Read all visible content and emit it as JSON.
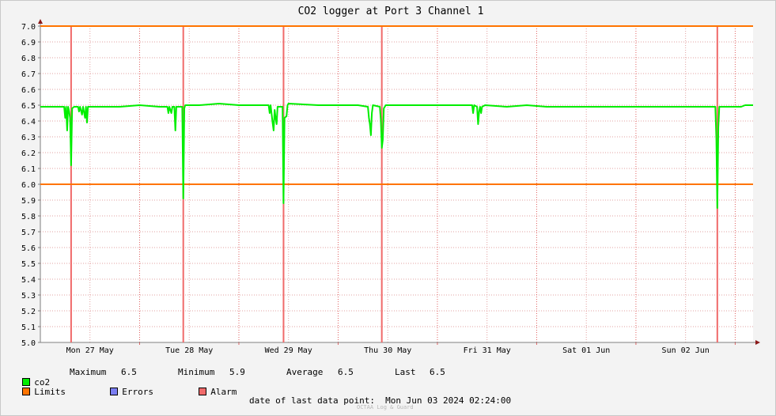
{
  "chart_data": {
    "type": "line",
    "title": "CO2 logger at Port 3 Channel 1",
    "ylim": [
      5.0,
      7.0
    ],
    "y_ticks": [
      "5.0",
      "5.1",
      "5.2",
      "5.3",
      "5.4",
      "5.5",
      "5.6",
      "5.7",
      "5.8",
      "5.9",
      "6.0",
      "6.1",
      "6.2",
      "6.3",
      "6.4",
      "6.5",
      "6.6",
      "6.7",
      "6.8",
      "6.9",
      "7.0"
    ],
    "x_range_days": [
      0,
      7.18
    ],
    "x_ticks": [
      {
        "label": "Mon 27 May",
        "day": 0.5
      },
      {
        "label": "Tue 28 May",
        "day": 1.5
      },
      {
        "label": "Wed 29 May",
        "day": 2.5
      },
      {
        "label": "Thu 30 May",
        "day": 3.5
      },
      {
        "label": "Fri 31 May",
        "day": 4.5
      },
      {
        "label": "Sat 01 Jun",
        "day": 5.5
      },
      {
        "label": "Sun 02 Jun",
        "day": 6.5
      }
    ],
    "grid": true,
    "limits": {
      "upper": 7.0,
      "lower": 6.0,
      "color": "#ff7400"
    },
    "alarms": {
      "days": [
        0.31,
        1.44,
        2.45,
        3.44,
        6.82
      ],
      "color": "#f06a6a"
    },
    "series": [
      {
        "name": "co2",
        "color": "#00ee00",
        "points": [
          [
            0.0,
            6.49
          ],
          [
            0.2,
            6.49
          ],
          [
            0.24,
            6.49
          ],
          [
            0.25,
            6.42
          ],
          [
            0.26,
            6.49
          ],
          [
            0.27,
            6.34
          ],
          [
            0.28,
            6.49
          ],
          [
            0.29,
            6.46
          ],
          [
            0.3,
            6.42
          ],
          [
            0.31,
            6.12
          ],
          [
            0.32,
            6.48
          ],
          [
            0.34,
            6.49
          ],
          [
            0.38,
            6.49
          ],
          [
            0.39,
            6.46
          ],
          [
            0.4,
            6.49
          ],
          [
            0.42,
            6.44
          ],
          [
            0.43,
            6.49
          ],
          [
            0.45,
            6.42
          ],
          [
            0.46,
            6.49
          ],
          [
            0.47,
            6.39
          ],
          [
            0.48,
            6.49
          ],
          [
            0.6,
            6.49
          ],
          [
            0.8,
            6.49
          ],
          [
            1.0,
            6.5
          ],
          [
            1.2,
            6.49
          ],
          [
            1.28,
            6.49
          ],
          [
            1.29,
            6.45
          ],
          [
            1.3,
            6.49
          ],
          [
            1.32,
            6.45
          ],
          [
            1.33,
            6.49
          ],
          [
            1.35,
            6.49
          ],
          [
            1.36,
            6.34
          ],
          [
            1.37,
            6.49
          ],
          [
            1.4,
            6.49
          ],
          [
            1.43,
            6.49
          ],
          [
            1.44,
            5.91
          ],
          [
            1.45,
            6.48
          ],
          [
            1.46,
            6.5
          ],
          [
            1.6,
            6.5
          ],
          [
            1.8,
            6.51
          ],
          [
            2.0,
            6.5
          ],
          [
            2.2,
            6.5
          ],
          [
            2.3,
            6.5
          ],
          [
            2.31,
            6.45
          ],
          [
            2.32,
            6.5
          ],
          [
            2.34,
            6.39
          ],
          [
            2.35,
            6.34
          ],
          [
            2.36,
            6.47
          ],
          [
            2.37,
            6.42
          ],
          [
            2.38,
            6.38
          ],
          [
            2.39,
            6.49
          ],
          [
            2.42,
            6.49
          ],
          [
            2.44,
            6.49
          ],
          [
            2.45,
            5.88
          ],
          [
            2.46,
            6.42
          ],
          [
            2.48,
            6.43
          ],
          [
            2.49,
            6.5
          ],
          [
            2.5,
            6.51
          ],
          [
            2.8,
            6.5
          ],
          [
            3.0,
            6.5
          ],
          [
            3.2,
            6.5
          ],
          [
            3.3,
            6.49
          ],
          [
            3.31,
            6.42
          ],
          [
            3.32,
            6.38
          ],
          [
            3.33,
            6.31
          ],
          [
            3.34,
            6.45
          ],
          [
            3.35,
            6.5
          ],
          [
            3.42,
            6.49
          ],
          [
            3.43,
            6.41
          ],
          [
            3.44,
            6.23
          ],
          [
            3.45,
            6.28
          ],
          [
            3.46,
            6.48
          ],
          [
            3.48,
            6.5
          ],
          [
            3.7,
            6.5
          ],
          [
            3.9,
            6.5
          ],
          [
            4.1,
            6.5
          ],
          [
            4.3,
            6.5
          ],
          [
            4.35,
            6.5
          ],
          [
            4.36,
            6.45
          ],
          [
            4.37,
            6.5
          ],
          [
            4.4,
            6.49
          ],
          [
            4.41,
            6.38
          ],
          [
            4.42,
            6.46
          ],
          [
            4.43,
            6.49
          ],
          [
            4.44,
            6.45
          ],
          [
            4.45,
            6.49
          ],
          [
            4.48,
            6.5
          ],
          [
            4.7,
            6.49
          ],
          [
            4.9,
            6.5
          ],
          [
            5.1,
            6.49
          ],
          [
            5.3,
            6.49
          ],
          [
            5.5,
            6.49
          ],
          [
            5.7,
            6.49
          ],
          [
            5.9,
            6.49
          ],
          [
            6.1,
            6.49
          ],
          [
            6.3,
            6.49
          ],
          [
            6.5,
            6.49
          ],
          [
            6.7,
            6.49
          ],
          [
            6.8,
            6.49
          ],
          [
            6.81,
            6.29
          ],
          [
            6.82,
            5.85
          ],
          [
            6.83,
            6.36
          ],
          [
            6.84,
            6.49
          ],
          [
            6.9,
            6.49
          ],
          [
            7.0,
            6.49
          ],
          [
            7.06,
            6.49
          ],
          [
            7.1,
            6.5
          ],
          [
            7.18,
            6.5
          ]
        ]
      }
    ]
  },
  "legend": {
    "co2_label": "co2",
    "max_label": "Maximum",
    "max_value": "6.5",
    "min_label": "Minimum",
    "min_value": "5.9",
    "avg_label": "Average",
    "avg_value": "6.5",
    "last_label": "Last",
    "last_value": "6.5",
    "limits_label": "Limits",
    "errors_label": "Errors",
    "alarm_label": "Alarm",
    "colors": {
      "co2": "#00ee00",
      "limits": "#ff7400",
      "errors": "#7b7ef2",
      "alarm": "#f06a6a"
    }
  },
  "footer": {
    "last_point": "date of last data point:  Mon Jun 03 2024 02:24:00",
    "watermark": "OCTAA Log & Guard"
  }
}
